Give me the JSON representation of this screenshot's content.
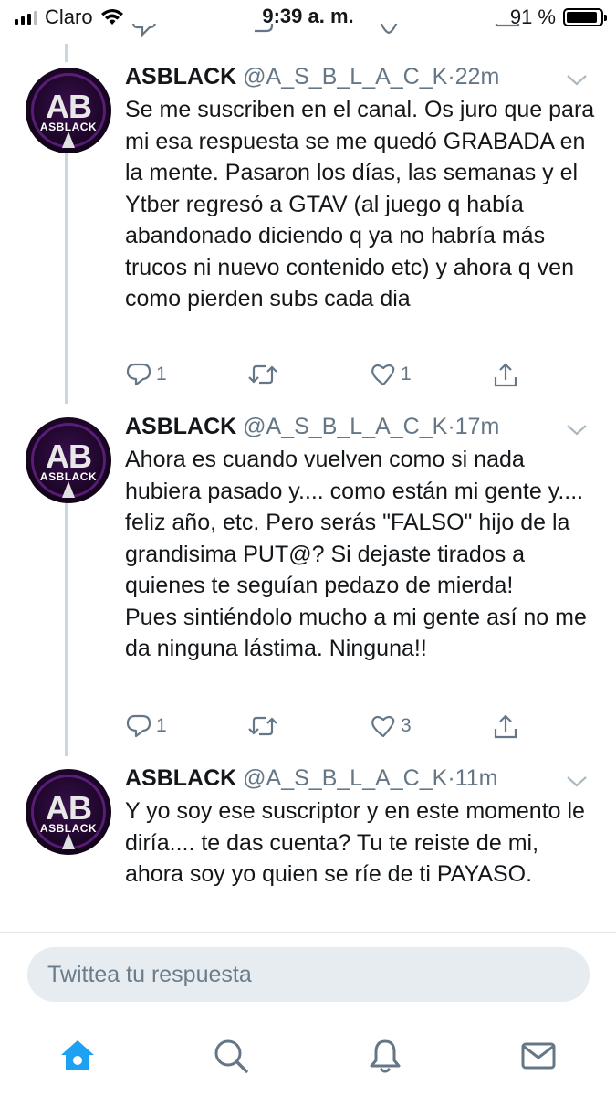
{
  "status_bar": {
    "carrier": "Claro",
    "time": "9:39 a. m.",
    "battery_percent": "91 %",
    "battery_level": 0.91
  },
  "tweets": [
    {
      "name": "ASBLACK",
      "handle": "@A_S_B_L_A_C_K",
      "separator": "·",
      "time": "22m",
      "avatar_initials": "AB",
      "avatar_caption": "ASBLACK",
      "text": "Se me suscriben en el canal. Os juro que para mi esa respuesta se me quedó GRABADA en la mente. Pasaron los días, las semanas y el Ytber regresó a GTAV (al juego q había abandonado diciendo q ya no habría más trucos ni nuevo contenido etc) y ahora q ven como pierden subs cada dia",
      "replies": "1",
      "retweets": "",
      "likes": "1"
    },
    {
      "name": "ASBLACK",
      "handle": "@A_S_B_L_A_C_K",
      "separator": "·",
      "time": "17m",
      "avatar_initials": "AB",
      "avatar_caption": "ASBLACK",
      "text": "Ahora es cuando vuelven como si nada hubiera pasado y.... como están mi gente y.... feliz año, etc. Pero serás \"FALSO\" hijo de la grandisima PUT@? Si dejaste tirados a quienes te seguían pedazo de mierda!\nPues sintiéndolo mucho a mi gente así no me da ninguna lástima. Ninguna!!",
      "replies": "1",
      "retweets": "",
      "likes": "3"
    },
    {
      "name": "ASBLACK",
      "handle": "@A_S_B_L_A_C_K",
      "separator": "·",
      "time": "11m",
      "avatar_initials": "AB",
      "avatar_caption": "ASBLACK",
      "text": "Y yo soy ese suscriptor y en este momento le diría.... te das cuenta? Tu te reiste de mi, ahora soy yo quien se ríe de ti PAYASO.",
      "replies": "",
      "retweets": "",
      "likes": ""
    }
  ],
  "reply": {
    "placeholder": "Twittea tu respuesta"
  },
  "tabbar": {
    "items": [
      "home-icon",
      "search-icon",
      "notifications-icon",
      "messages-icon"
    ],
    "active": "home-icon"
  },
  "colors": {
    "accent": "#1da1f2",
    "muted": "#657786",
    "thread_line": "#ccd6dd",
    "reply_bg": "#e6ecf0"
  }
}
